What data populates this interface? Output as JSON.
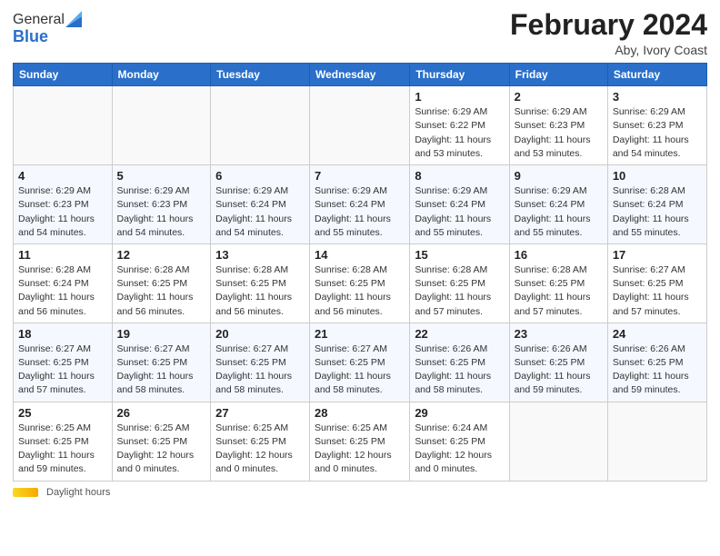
{
  "logo": {
    "general": "General",
    "blue": "Blue"
  },
  "title": "February 2024",
  "subtitle": "Aby, Ivory Coast",
  "days_of_week": [
    "Sunday",
    "Monday",
    "Tuesday",
    "Wednesday",
    "Thursday",
    "Friday",
    "Saturday"
  ],
  "footer": {
    "daylight_label": "Daylight hours"
  },
  "weeks": [
    [
      {
        "day": "",
        "info": ""
      },
      {
        "day": "",
        "info": ""
      },
      {
        "day": "",
        "info": ""
      },
      {
        "day": "",
        "info": ""
      },
      {
        "day": "1",
        "info": "Sunrise: 6:29 AM\nSunset: 6:22 PM\nDaylight: 11 hours\nand 53 minutes."
      },
      {
        "day": "2",
        "info": "Sunrise: 6:29 AM\nSunset: 6:23 PM\nDaylight: 11 hours\nand 53 minutes."
      },
      {
        "day": "3",
        "info": "Sunrise: 6:29 AM\nSunset: 6:23 PM\nDaylight: 11 hours\nand 54 minutes."
      }
    ],
    [
      {
        "day": "4",
        "info": "Sunrise: 6:29 AM\nSunset: 6:23 PM\nDaylight: 11 hours\nand 54 minutes."
      },
      {
        "day": "5",
        "info": "Sunrise: 6:29 AM\nSunset: 6:23 PM\nDaylight: 11 hours\nand 54 minutes."
      },
      {
        "day": "6",
        "info": "Sunrise: 6:29 AM\nSunset: 6:24 PM\nDaylight: 11 hours\nand 54 minutes."
      },
      {
        "day": "7",
        "info": "Sunrise: 6:29 AM\nSunset: 6:24 PM\nDaylight: 11 hours\nand 55 minutes."
      },
      {
        "day": "8",
        "info": "Sunrise: 6:29 AM\nSunset: 6:24 PM\nDaylight: 11 hours\nand 55 minutes."
      },
      {
        "day": "9",
        "info": "Sunrise: 6:29 AM\nSunset: 6:24 PM\nDaylight: 11 hours\nand 55 minutes."
      },
      {
        "day": "10",
        "info": "Sunrise: 6:28 AM\nSunset: 6:24 PM\nDaylight: 11 hours\nand 55 minutes."
      }
    ],
    [
      {
        "day": "11",
        "info": "Sunrise: 6:28 AM\nSunset: 6:24 PM\nDaylight: 11 hours\nand 56 minutes."
      },
      {
        "day": "12",
        "info": "Sunrise: 6:28 AM\nSunset: 6:25 PM\nDaylight: 11 hours\nand 56 minutes."
      },
      {
        "day": "13",
        "info": "Sunrise: 6:28 AM\nSunset: 6:25 PM\nDaylight: 11 hours\nand 56 minutes."
      },
      {
        "day": "14",
        "info": "Sunrise: 6:28 AM\nSunset: 6:25 PM\nDaylight: 11 hours\nand 56 minutes."
      },
      {
        "day": "15",
        "info": "Sunrise: 6:28 AM\nSunset: 6:25 PM\nDaylight: 11 hours\nand 57 minutes."
      },
      {
        "day": "16",
        "info": "Sunrise: 6:28 AM\nSunset: 6:25 PM\nDaylight: 11 hours\nand 57 minutes."
      },
      {
        "day": "17",
        "info": "Sunrise: 6:27 AM\nSunset: 6:25 PM\nDaylight: 11 hours\nand 57 minutes."
      }
    ],
    [
      {
        "day": "18",
        "info": "Sunrise: 6:27 AM\nSunset: 6:25 PM\nDaylight: 11 hours\nand 57 minutes."
      },
      {
        "day": "19",
        "info": "Sunrise: 6:27 AM\nSunset: 6:25 PM\nDaylight: 11 hours\nand 58 minutes."
      },
      {
        "day": "20",
        "info": "Sunrise: 6:27 AM\nSunset: 6:25 PM\nDaylight: 11 hours\nand 58 minutes."
      },
      {
        "day": "21",
        "info": "Sunrise: 6:27 AM\nSunset: 6:25 PM\nDaylight: 11 hours\nand 58 minutes."
      },
      {
        "day": "22",
        "info": "Sunrise: 6:26 AM\nSunset: 6:25 PM\nDaylight: 11 hours\nand 58 minutes."
      },
      {
        "day": "23",
        "info": "Sunrise: 6:26 AM\nSunset: 6:25 PM\nDaylight: 11 hours\nand 59 minutes."
      },
      {
        "day": "24",
        "info": "Sunrise: 6:26 AM\nSunset: 6:25 PM\nDaylight: 11 hours\nand 59 minutes."
      }
    ],
    [
      {
        "day": "25",
        "info": "Sunrise: 6:25 AM\nSunset: 6:25 PM\nDaylight: 11 hours\nand 59 minutes."
      },
      {
        "day": "26",
        "info": "Sunrise: 6:25 AM\nSunset: 6:25 PM\nDaylight: 12 hours\nand 0 minutes."
      },
      {
        "day": "27",
        "info": "Sunrise: 6:25 AM\nSunset: 6:25 PM\nDaylight: 12 hours\nand 0 minutes."
      },
      {
        "day": "28",
        "info": "Sunrise: 6:25 AM\nSunset: 6:25 PM\nDaylight: 12 hours\nand 0 minutes."
      },
      {
        "day": "29",
        "info": "Sunrise: 6:24 AM\nSunset: 6:25 PM\nDaylight: 12 hours\nand 0 minutes."
      },
      {
        "day": "",
        "info": ""
      },
      {
        "day": "",
        "info": ""
      }
    ]
  ]
}
